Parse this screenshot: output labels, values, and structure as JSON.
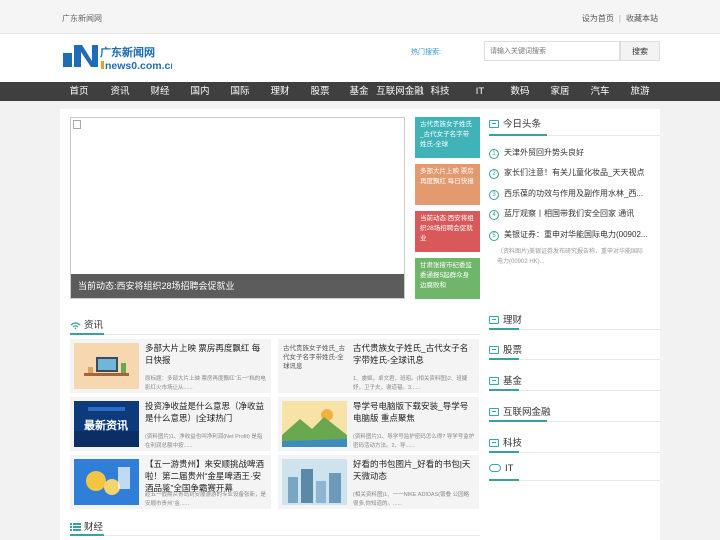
{
  "topbar": {
    "site_name": "广东新闻网",
    "set_home": "设为首页",
    "separator": "|",
    "bookmark": "收藏本站"
  },
  "header": {
    "logo": {
      "brand": "广东新闻网",
      "domain": "news0.com.cn"
    },
    "hot_label": "热门搜索:",
    "search_placeholder": "请输入关键词搜索",
    "search_button": "搜索"
  },
  "nav": [
    "首页",
    "资讯",
    "财经",
    "国内",
    "国际",
    "理财",
    "股票",
    "基金",
    "互联网金融",
    "科技",
    "IT",
    "数码",
    "家居",
    "汽车",
    "旅游"
  ],
  "slider": {
    "caption": "当前动态:西安将组织28场招聘会促就业"
  },
  "mini_news": [
    {
      "text": "古代贵族女子姓氏_古代女子名字带姓氏-全球",
      "color": "#3fb3b8"
    },
    {
      "text": "多部大片上映 票房再度飘红 每日快报",
      "color": "#e49a6f"
    },
    {
      "text": "当前动态:西安将组织28场招聘会促就业",
      "color": "#d9595b"
    },
    {
      "text": "甘肃张掖市纪委监委通报5起群众身边腐败和",
      "color": "#6fb56a"
    }
  ],
  "sidebar": {
    "headlines_title": "今日头条",
    "headlines": [
      "天津外贸回升势头良好",
      "家长们注意！有关儿童化妆品_天天视点",
      "西乐葆的功效与作用及副作用水林_西...",
      "蓝厅观察丨相国带我们安全回家 通讯",
      "美银证券：重申对华能国际电力(00902..."
    ],
    "headline_summary": "（资料图片)美银证券发布研究报告称，重申对华能国际电力(00902 HK)...",
    "categories": [
      "理财",
      "股票",
      "基金",
      "互联网金融",
      "科技",
      "IT"
    ]
  },
  "sections": {
    "news": "资讯",
    "finance": "财经"
  },
  "cards": [
    {
      "title": "多部大片上映 票房再度飘红 每日快报",
      "desc": "原标题：多部大片上映 票房再度飘红“五一”档的电影红火市场让从......",
      "thumb": "desk"
    },
    {
      "title": "古代贵族女子姓氏_古代女子名字带姓氏-全球讯息",
      "desc": "1、虞姬，卓文君，班昭。(相关资料图)2、班婕妤，卫子夫，谢道韫。3......",
      "thumb": "broken",
      "alt": "古代贵族女子姓氏_古代女子名字带姓氏-全球讯息"
    },
    {
      "title": "投资净收益是什么意思（净收益是什么意思）|全球热门",
      "desc": "(资料图片)1、净收益也叫净利润(Net Profit) 是指在利润总额中按......",
      "thumb": "latest",
      "badge": "最新资讯"
    },
    {
      "title": "导学号电脑版下载安装_导学号电脑版 重点聚焦",
      "desc": "(资料图片)1、导学号监护密码怎么得? 导学号监护密码活动方法。2、导......",
      "thumb": "landscape"
    },
    {
      "title": "【五一游贵州】来安顺挑战啤酒啦！第二届贵州“金星啤酒王·安酒品鉴”全国争霸赛开幕",
      "desc": "趁五一假期从青岛到安顺游游的专业设备张新，是安顺市贵州“金......",
      "thumb": "coins"
    },
    {
      "title": "好看的书包图片_好看的书包|天天微动态",
      "desc": "(相关资料图)1、一一NIKE ADIDAS(锻叠 公园略 很多,你知道的。......",
      "thumb": "city"
    }
  ],
  "colors": {
    "accent": "#3aa0a0",
    "nav_bg": "#3f3f3f",
    "logo_blue": "#1e6db5"
  }
}
